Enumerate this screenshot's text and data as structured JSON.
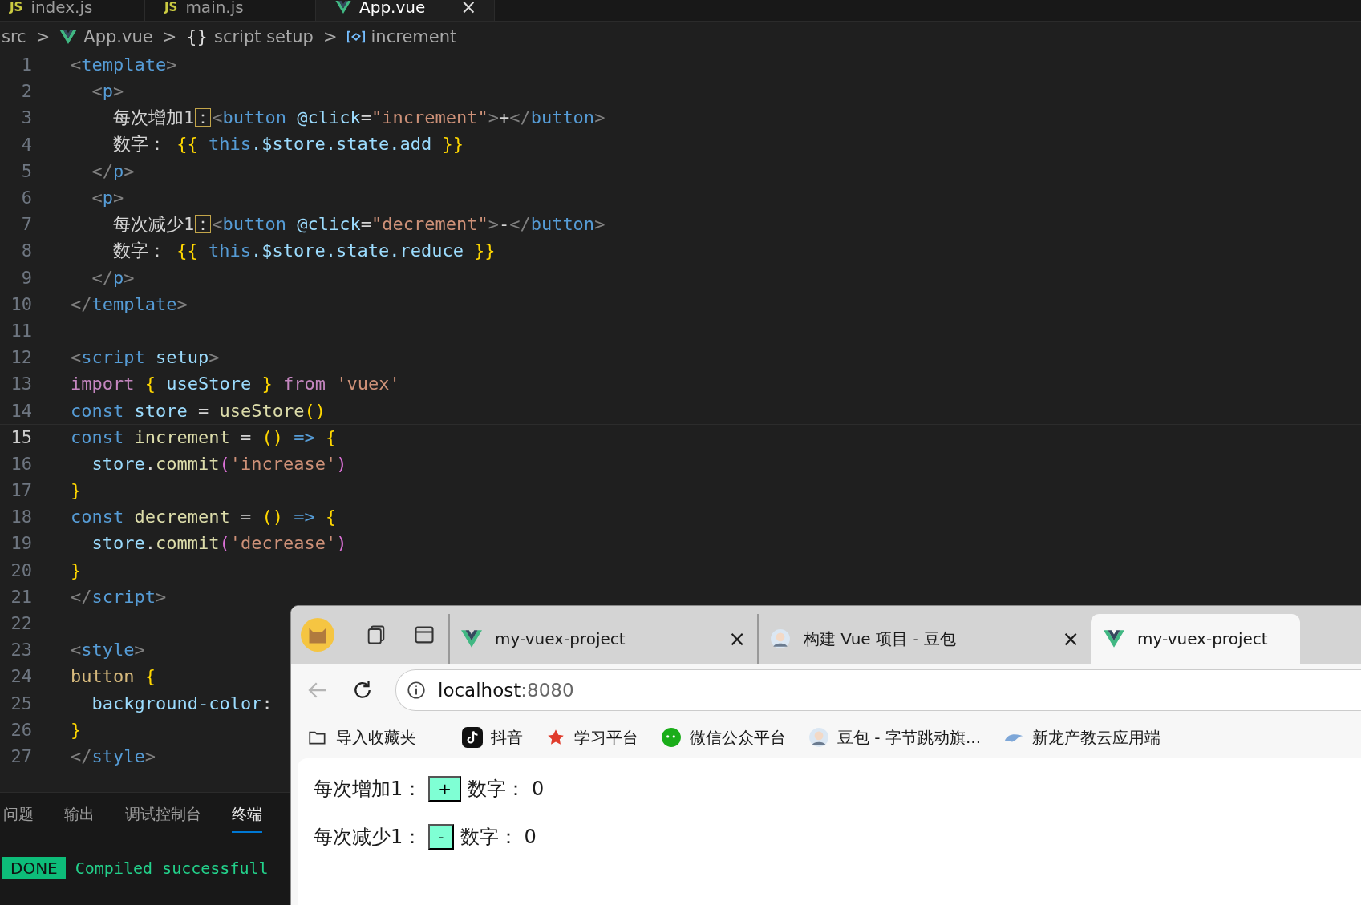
{
  "editor": {
    "tabs": [
      {
        "label": "index.js",
        "badge": "JS",
        "selected": false
      },
      {
        "label": "main.js",
        "badge": "JS",
        "selected": false
      },
      {
        "label": "App.vue",
        "selected": true,
        "close": "×"
      }
    ],
    "breadcrumb": [
      {
        "label": "src"
      },
      {
        "label": "App.vue"
      },
      {
        "label": "script setup",
        "glyph": "{}"
      },
      {
        "label": "increment"
      }
    ],
    "breadcrumb_separator": ">",
    "lines": [
      {
        "number": "1",
        "current": false,
        "tokens": [
          {
            "text": "<",
            "kind": "bracket"
          },
          {
            "text": "template",
            "kind": "tag"
          },
          {
            "text": ">",
            "kind": "bracket"
          }
        ]
      },
      {
        "number": "2",
        "current": false,
        "tokens": [
          {
            "text": "  <",
            "kind": "bracket"
          },
          {
            "text": "p",
            "kind": "tag"
          },
          {
            "text": ">",
            "kind": "bracket"
          }
        ]
      },
      {
        "number": "3",
        "current": false,
        "tokens": [
          {
            "text": "    每次增加1",
            "kind": "text"
          },
          {
            "text": "：",
            "kind": "flagged"
          },
          {
            "text": "<",
            "kind": "bracket"
          },
          {
            "text": "button",
            "kind": "tag"
          },
          {
            "text": " @click",
            "kind": "attr"
          },
          {
            "text": "=",
            "kind": "text"
          },
          {
            "text": "\"increment\"",
            "kind": "string"
          },
          {
            "text": ">",
            "kind": "bracket"
          },
          {
            "text": "+",
            "kind": "text"
          },
          {
            "text": "</",
            "kind": "bracket"
          },
          {
            "text": "button",
            "kind": "tag"
          },
          {
            "text": ">",
            "kind": "bracket"
          }
        ]
      },
      {
        "number": "4",
        "current": false,
        "tokens": [
          {
            "text": "    数字：",
            "kind": "text"
          },
          {
            "text": " {{",
            "kind": "brace"
          },
          {
            "text": " this",
            "kind": "storage"
          },
          {
            "text": ".$store.state.add",
            "kind": "variable"
          },
          {
            "text": " }}",
            "kind": "brace"
          }
        ]
      },
      {
        "number": "5",
        "current": false,
        "tokens": [
          {
            "text": "  </",
            "kind": "bracket"
          },
          {
            "text": "p",
            "kind": "tag"
          },
          {
            "text": ">",
            "kind": "bracket"
          }
        ]
      },
      {
        "number": "6",
        "current": false,
        "tokens": [
          {
            "text": "  <",
            "kind": "bracket"
          },
          {
            "text": "p",
            "kind": "tag"
          },
          {
            "text": ">",
            "kind": "bracket"
          }
        ]
      },
      {
        "number": "7",
        "current": false,
        "tokens": [
          {
            "text": "    每次减少1",
            "kind": "text"
          },
          {
            "text": "：",
            "kind": "flagged"
          },
          {
            "text": "<",
            "kind": "bracket"
          },
          {
            "text": "button",
            "kind": "tag"
          },
          {
            "text": " @click",
            "kind": "attr"
          },
          {
            "text": "=",
            "kind": "text"
          },
          {
            "text": "\"decrement\"",
            "kind": "string"
          },
          {
            "text": ">",
            "kind": "bracket"
          },
          {
            "text": "-",
            "kind": "text"
          },
          {
            "text": "</",
            "kind": "bracket"
          },
          {
            "text": "button",
            "kind": "tag"
          },
          {
            "text": ">",
            "kind": "bracket"
          }
        ]
      },
      {
        "number": "8",
        "current": false,
        "tokens": [
          {
            "text": "    数字：",
            "kind": "text"
          },
          {
            "text": " {{",
            "kind": "brace"
          },
          {
            "text": " this",
            "kind": "storage"
          },
          {
            "text": ".$store.state.reduce",
            "kind": "variable"
          },
          {
            "text": " }}",
            "kind": "brace"
          }
        ]
      },
      {
        "number": "9",
        "current": false,
        "tokens": [
          {
            "text": "  </",
            "kind": "bracket"
          },
          {
            "text": "p",
            "kind": "tag"
          },
          {
            "text": ">",
            "kind": "bracket"
          }
        ]
      },
      {
        "number": "10",
        "current": false,
        "tokens": [
          {
            "text": "</",
            "kind": "bracket"
          },
          {
            "text": "template",
            "kind": "tag"
          },
          {
            "text": ">",
            "kind": "bracket"
          }
        ]
      },
      {
        "number": "11",
        "current": false
      },
      {
        "number": "12",
        "current": false,
        "tokens": [
          {
            "text": "<",
            "kind": "bracket"
          },
          {
            "text": "script",
            "kind": "tag"
          },
          {
            "text": " setup",
            "kind": "attr"
          },
          {
            "text": ">",
            "kind": "bracket"
          }
        ]
      },
      {
        "number": "13",
        "current": false,
        "tokens": [
          {
            "text": "import",
            "kind": "keyword"
          },
          {
            "text": " {",
            "kind": "brace"
          },
          {
            "text": " useStore",
            "kind": "variable"
          },
          {
            "text": " }",
            "kind": "brace"
          },
          {
            "text": " from",
            "kind": "keyword"
          },
          {
            "text": " 'vuex'",
            "kind": "string"
          }
        ]
      },
      {
        "number": "14",
        "current": false,
        "tokens": [
          {
            "text": "const",
            "kind": "storage"
          },
          {
            "text": " store",
            "kind": "variable"
          },
          {
            "text": " =",
            "kind": "text"
          },
          {
            "text": " useStore",
            "kind": "function"
          },
          {
            "text": "()",
            "kind": "brace"
          }
        ]
      },
      {
        "number": "15",
        "current": true,
        "tokens": [
          {
            "text": "const",
            "kind": "storage"
          },
          {
            "text": " increment",
            "kind": "function"
          },
          {
            "text": " =",
            "kind": "text"
          },
          {
            "text": " ()",
            "kind": "brace"
          },
          {
            "text": " =>",
            "kind": "storage"
          },
          {
            "text": " {",
            "kind": "brace"
          }
        ]
      },
      {
        "number": "16",
        "current": false,
        "tokens": [
          {
            "text": "  store",
            "kind": "variable"
          },
          {
            "text": ".",
            "kind": "text"
          },
          {
            "text": "commit",
            "kind": "function"
          },
          {
            "text": "(",
            "kind": "paren"
          },
          {
            "text": "'increase'",
            "kind": "string"
          },
          {
            "text": ")",
            "kind": "paren"
          }
        ]
      },
      {
        "number": "17",
        "current": false,
        "tokens": [
          {
            "text": "}",
            "kind": "brace"
          }
        ]
      },
      {
        "number": "18",
        "current": false,
        "tokens": [
          {
            "text": "const",
            "kind": "storage"
          },
          {
            "text": " decrement",
            "kind": "function"
          },
          {
            "text": " =",
            "kind": "text"
          },
          {
            "text": " ()",
            "kind": "brace"
          },
          {
            "text": " =>",
            "kind": "storage"
          },
          {
            "text": " {",
            "kind": "brace"
          }
        ]
      },
      {
        "number": "19",
        "current": false,
        "tokens": [
          {
            "text": "  store",
            "kind": "variable"
          },
          {
            "text": ".",
            "kind": "text"
          },
          {
            "text": "commit",
            "kind": "function"
          },
          {
            "text": "(",
            "kind": "paren"
          },
          {
            "text": "'decrease'",
            "kind": "string"
          },
          {
            "text": ")",
            "kind": "paren"
          }
        ]
      },
      {
        "number": "20",
        "current": false,
        "tokens": [
          {
            "text": "}",
            "kind": "brace"
          }
        ]
      },
      {
        "number": "21",
        "current": false,
        "tokens": [
          {
            "text": "</",
            "kind": "bracket"
          },
          {
            "text": "script",
            "kind": "tag"
          },
          {
            "text": ">",
            "kind": "bracket"
          }
        ]
      },
      {
        "number": "22",
        "current": false
      },
      {
        "number": "23",
        "current": false,
        "tokens": [
          {
            "text": "<",
            "kind": "bracket"
          },
          {
            "text": "style",
            "kind": "tag"
          },
          {
            "text": ">",
            "kind": "bracket"
          }
        ]
      },
      {
        "number": "24",
        "current": false,
        "tokens": [
          {
            "text": "button",
            "kind": "selector"
          },
          {
            "text": " {",
            "kind": "brace"
          }
        ]
      },
      {
        "number": "25",
        "current": false,
        "tokens": [
          {
            "text": "  background-color",
            "kind": "variable"
          },
          {
            "text": ":",
            "kind": "text"
          }
        ]
      },
      {
        "number": "26",
        "current": false,
        "tokens": [
          {
            "text": "}",
            "kind": "brace"
          }
        ]
      },
      {
        "number": "27",
        "current": false,
        "tokens": [
          {
            "text": "</",
            "kind": "bracket"
          },
          {
            "text": "style",
            "kind": "tag"
          },
          {
            "text": ">",
            "kind": "bracket"
          }
        ]
      }
    ]
  },
  "panel": {
    "tabs": [
      {
        "label": "问题",
        "selected": false
      },
      {
        "label": "输出",
        "selected": false
      },
      {
        "label": "调试控制台",
        "selected": false
      },
      {
        "label": "终端",
        "selected": true
      }
    ],
    "terminal": {
      "badge": "DONE",
      "message": "Compiled successfull"
    }
  },
  "browser": {
    "tabs": [
      {
        "title": "my-vuex-project",
        "selected": false,
        "close": "×"
      },
      {
        "title": "构建 Vue 项目 - 豆包",
        "selected": false,
        "close": "×"
      },
      {
        "title": "my-vuex-project",
        "selected": true
      }
    ],
    "back_disabled": true,
    "address": {
      "host": "localhost",
      "port": ":8080"
    },
    "bookmarks": [
      {
        "label": "导入收藏夹"
      },
      {
        "label": "抖音"
      },
      {
        "label": "学习平台"
      },
      {
        "label": "微信公众平台"
      },
      {
        "label": "豆包 - 字节跳动旗..."
      },
      {
        "label": "新龙产教云应用端"
      }
    ],
    "page": {
      "rows": [
        {
          "label": "每次增加1：",
          "button": "+",
          "counter_label": "数字：",
          "value": "0"
        },
        {
          "label": "每次减少1：",
          "button": "-",
          "counter_label": "数字：",
          "value": "0"
        }
      ]
    }
  }
}
